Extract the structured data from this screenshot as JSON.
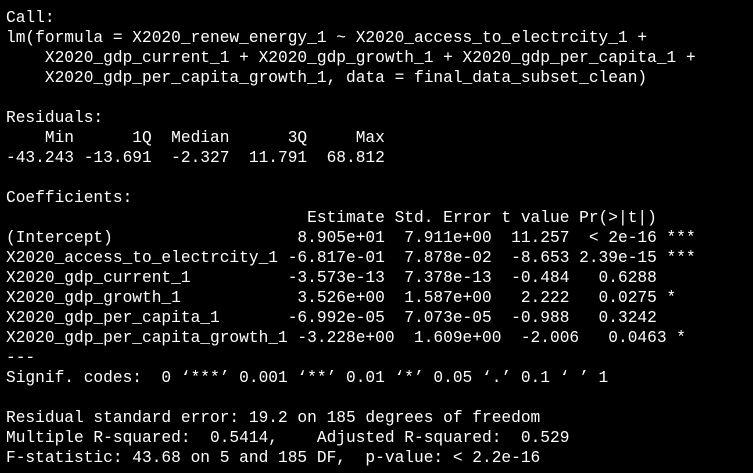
{
  "console": {
    "lines": [
      "Call:",
      "lm(formula = X2020_renew_energy_1 ~ X2020_access_to_electrcity_1 +",
      "    X2020_gdp_current_1 + X2020_gdp_growth_1 + X2020_gdp_per_capita_1 +",
      "    X2020_gdp_per_capita_growth_1, data = final_data_subset_clean)",
      "",
      "Residuals:",
      "    Min      1Q  Median      3Q     Max ",
      "-43.243 -13.691  -2.327  11.791  68.812 ",
      "",
      "Coefficients:",
      "                               Estimate Std. Error t value Pr(>|t|)    ",
      "(Intercept)                   8.905e+01  7.911e+00  11.257  < 2e-16 ***",
      "X2020_access_to_electrcity_1 -6.817e-01  7.878e-02  -8.653 2.39e-15 ***",
      "X2020_gdp_current_1          -3.573e-13  7.378e-13  -0.484   0.6288    ",
      "X2020_gdp_growth_1            3.526e+00  1.587e+00   2.222   0.0275 *  ",
      "X2020_gdp_per_capita_1       -6.992e-05  7.073e-05  -0.988   0.3242    ",
      "X2020_gdp_per_capita_growth_1 -3.228e+00  1.609e+00  -2.006   0.0463 *  ",
      "---",
      "Signif. codes:  0 ‘***’ 0.001 ‘**’ 0.01 ‘*’ 0.05 ‘.’ 0.1 ‘ ’ 1",
      "",
      "Residual standard error: 19.2 on 185 degrees of freedom",
      "Multiple R-squared:  0.5414,\tAdjusted R-squared:  0.529 ",
      "F-statistic: 43.68 on 5 and 185 DF,  p-value: < 2.2e-16"
    ]
  }
}
